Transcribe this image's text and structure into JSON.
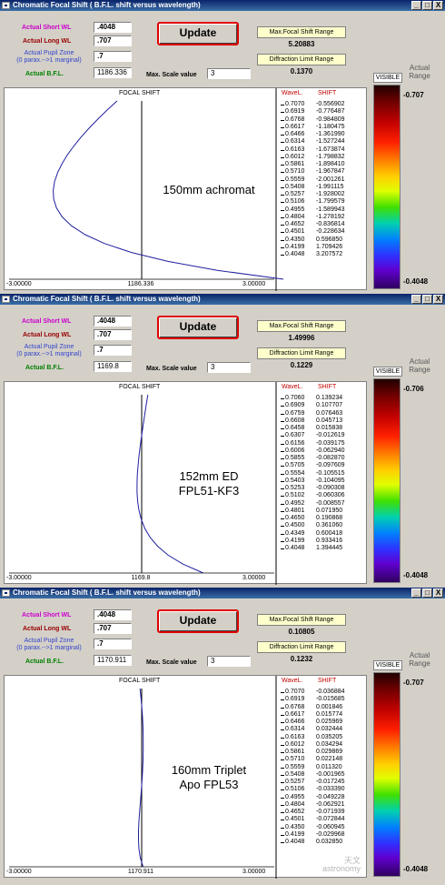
{
  "window_title": "Chromatic Focal Shift  ( B.F.L. shift versus wavelength)",
  "window_buttons": {
    "minimize": "_",
    "maximize": "□",
    "close": "X"
  },
  "labels": {
    "short_wl": "Actual Short WL",
    "long_wl": "Actual Long WL",
    "pupil_zone_line1": "Actual  Pupil  Zone",
    "pupil_zone_line2": "(0 parax.-->1 marginal)",
    "bfl": "Actual   B.F.L.",
    "update_button": "Update",
    "max_scale": "Max. Scale value",
    "max_focal_shift_range": "Max.Focal Shift Range",
    "diffraction_limit_range": "Diffraction Limit Range",
    "visible_button": "VISIBLE",
    "actual_range_line1": "Actual",
    "actual_range_line2": "Range",
    "plot_title": "FOCAL SHIFT",
    "col_wavel": "WaveL.",
    "col_shift": "SHIFT"
  },
  "panels": [
    {
      "short_wl": ".4048",
      "long_wl": ".707",
      "pupil_zone": ".7",
      "bfl": "1186.336",
      "max_scale": "3",
      "max_focal_shift": "5.20883",
      "diffraction_limit": "0.1370",
      "colorbar_top": "-0.707",
      "colorbar_bottom": "-0.4048",
      "axis_left": "-3.00000",
      "axis_center": "1186.336",
      "axis_right": "3.00000",
      "lens_line1": "150mm achromat",
      "lens_line2": "",
      "table": [
        {
          "wl": "0.7070",
          "shift": "-0.556902"
        },
        {
          "wl": "0.6919",
          "shift": "-0.776487"
        },
        {
          "wl": "0.6768",
          "shift": "-0.984809"
        },
        {
          "wl": "0.6617",
          "shift": "-1.180475"
        },
        {
          "wl": "0.6466",
          "shift": "-1.361990"
        },
        {
          "wl": "0.6314",
          "shift": "-1.527244"
        },
        {
          "wl": "0.6163",
          "shift": "-1.673874"
        },
        {
          "wl": "0.6012",
          "shift": "-1.798832"
        },
        {
          "wl": "0.5861",
          "shift": "-1.898410"
        },
        {
          "wl": "0.5710",
          "shift": "-1.967847"
        },
        {
          "wl": "0.5559",
          "shift": "-2.001261"
        },
        {
          "wl": "0.5408",
          "shift": "-1.991115"
        },
        {
          "wl": "0.5257",
          "shift": "-1.928002"
        },
        {
          "wl": "0.5106",
          "shift": "-1.799579"
        },
        {
          "wl": "0.4955",
          "shift": "-1.589943"
        },
        {
          "wl": "0.4804",
          "shift": "-1.278192"
        },
        {
          "wl": "0.4652",
          "shift": "-0.836814"
        },
        {
          "wl": "0.4501",
          "shift": "-0.228634"
        },
        {
          "wl": "0.4350",
          "shift": "0.596850"
        },
        {
          "wl": "0.4199",
          "shift": "1.709426"
        },
        {
          "wl": "0.4048",
          "shift": "3.207572"
        }
      ]
    },
    {
      "short_wl": ".4048",
      "long_wl": ".707",
      "pupil_zone": ".7",
      "bfl": "1169.8",
      "max_scale": "3",
      "max_focal_shift": "1.49996",
      "diffraction_limit": "0.1229",
      "colorbar_top": "-0.706",
      "colorbar_bottom": "-0.4048",
      "axis_left": "-3.00000",
      "axis_center": "1169.8",
      "axis_right": "3.00000",
      "lens_line1": "152mm ED",
      "lens_line2": "FPL51-KF3",
      "table": [
        {
          "wl": "0.7060",
          "shift": "0.139234"
        },
        {
          "wl": "0.6909",
          "shift": "0.107707"
        },
        {
          "wl": "0.6759",
          "shift": "0.076463"
        },
        {
          "wl": "0.6608",
          "shift": "0.045713"
        },
        {
          "wl": "0.6458",
          "shift": "0.015838"
        },
        {
          "wl": "0.6307",
          "shift": "-0.012619"
        },
        {
          "wl": "0.6156",
          "shift": "-0.039175"
        },
        {
          "wl": "0.6006",
          "shift": "-0.062940"
        },
        {
          "wl": "0.5855",
          "shift": "-0.082870"
        },
        {
          "wl": "0.5705",
          "shift": "-0.097609"
        },
        {
          "wl": "0.5554",
          "shift": "-0.105515"
        },
        {
          "wl": "0.5403",
          "shift": "-0.104095"
        },
        {
          "wl": "0.5253",
          "shift": "-0.090308"
        },
        {
          "wl": "0.5102",
          "shift": "-0.060306"
        },
        {
          "wl": "0.4952",
          "shift": "-0.008557"
        },
        {
          "wl": "0.4801",
          "shift": "0.071950"
        },
        {
          "wl": "0.4650",
          "shift": "0.190868"
        },
        {
          "wl": "0.4500",
          "shift": "0.361060"
        },
        {
          "wl": "0.4349",
          "shift": "0.600418"
        },
        {
          "wl": "0.4199",
          "shift": "0.933416"
        },
        {
          "wl": "0.4048",
          "shift": "1.394445"
        }
      ]
    },
    {
      "short_wl": ".4048",
      "long_wl": ".707",
      "pupil_zone": ".7",
      "bfl": "1170.911",
      "max_scale": "3",
      "max_focal_shift": "0.10805",
      "diffraction_limit": "0.1232",
      "colorbar_top": "-0.707",
      "colorbar_bottom": "-0.4048",
      "axis_left": "-3.00000",
      "axis_center": "1170.911",
      "axis_right": "3.00000",
      "lens_line1": "160mm Triplet",
      "lens_line2": "Apo FPL53",
      "table": [
        {
          "wl": "0.7070",
          "shift": "-0.036884"
        },
        {
          "wl": "0.6919",
          "shift": "-0.015685"
        },
        {
          "wl": "0.6768",
          "shift": "0.001846"
        },
        {
          "wl": "0.6617",
          "shift": "0.015774"
        },
        {
          "wl": "0.6466",
          "shift": "0.025969"
        },
        {
          "wl": "0.6314",
          "shift": "0.032444"
        },
        {
          "wl": "0.6163",
          "shift": "0.035205"
        },
        {
          "wl": "0.6012",
          "shift": "0.034294"
        },
        {
          "wl": "0.5861",
          "shift": "0.029869"
        },
        {
          "wl": "0.5710",
          "shift": "0.022148"
        },
        {
          "wl": "0.5559",
          "shift": "0.011320"
        },
        {
          "wl": "0.5408",
          "shift": "-0.001965"
        },
        {
          "wl": "0.5257",
          "shift": "-0.017245"
        },
        {
          "wl": "0.5106",
          "shift": "-0.033390"
        },
        {
          "wl": "0.4955",
          "shift": "-0.049228"
        },
        {
          "wl": "0.4804",
          "shift": "-0.062921"
        },
        {
          "wl": "0.4652",
          "shift": "-0.071939"
        },
        {
          "wl": "0.4501",
          "shift": "-0.072844"
        },
        {
          "wl": "0.4350",
          "shift": "-0.060945"
        },
        {
          "wl": "0.4199",
          "shift": "-0.029968"
        },
        {
          "wl": "0.4048",
          "shift": "0.032850"
        }
      ]
    }
  ],
  "chart_data": [
    {
      "type": "line",
      "title": "FOCAL SHIFT",
      "xlim": [
        -3,
        3
      ],
      "x": [
        -0.556902,
        -0.776487,
        -0.984809,
        -1.180475,
        -1.36199,
        -1.527244,
        -1.673874,
        -1.798832,
        -1.89841,
        -1.967847,
        -2.001261,
        -1.991115,
        -1.928002,
        -1.799579,
        -1.589943,
        -1.278192,
        -0.836814,
        -0.228634,
        0.59685,
        1.709426,
        3.207572
      ],
      "y": [
        0.707,
        0.6919,
        0.6768,
        0.6617,
        0.6466,
        0.6314,
        0.6163,
        0.6012,
        0.5861,
        0.571,
        0.5559,
        0.5408,
        0.5257,
        0.5106,
        0.4955,
        0.4804,
        0.4652,
        0.4501,
        0.435,
        0.4199,
        0.4048
      ]
    },
    {
      "type": "line",
      "title": "FOCAL SHIFT",
      "xlim": [
        -3,
        3
      ],
      "x": [
        0.139234,
        0.107707,
        0.076463,
        0.045713,
        0.015838,
        -0.012619,
        -0.039175,
        -0.06294,
        -0.08287,
        -0.097609,
        -0.105515,
        -0.104095,
        -0.090308,
        -0.060306,
        -0.008557,
        0.07195,
        0.190868,
        0.36106,
        0.600418,
        0.933416,
        1.394445
      ],
      "y": [
        0.706,
        0.6909,
        0.6759,
        0.6608,
        0.6458,
        0.6307,
        0.6156,
        0.6006,
        0.5855,
        0.5705,
        0.5554,
        0.5403,
        0.5253,
        0.5102,
        0.4952,
        0.4801,
        0.465,
        0.45,
        0.4349,
        0.4199,
        0.4048
      ]
    },
    {
      "type": "line",
      "title": "FOCAL SHIFT",
      "xlim": [
        -3,
        3
      ],
      "x": [
        -0.036884,
        -0.015685,
        0.001846,
        0.015774,
        0.025969,
        0.032444,
        0.035205,
        0.034294,
        0.029869,
        0.022148,
        0.01132,
        -0.001965,
        -0.017245,
        -0.03339,
        -0.049228,
        -0.062921,
        -0.071939,
        -0.072844,
        -0.060945,
        -0.029968,
        0.03285
      ],
      "y": [
        0.707,
        0.6919,
        0.6768,
        0.6617,
        0.6466,
        0.6314,
        0.6163,
        0.6012,
        0.5861,
        0.571,
        0.5559,
        0.5408,
        0.5257,
        0.5106,
        0.4955,
        0.4804,
        0.4652,
        0.4501,
        0.435,
        0.4199,
        0.4048
      ]
    }
  ],
  "watermark": {
    "line1": "天文",
    "line2": "astronomy"
  }
}
